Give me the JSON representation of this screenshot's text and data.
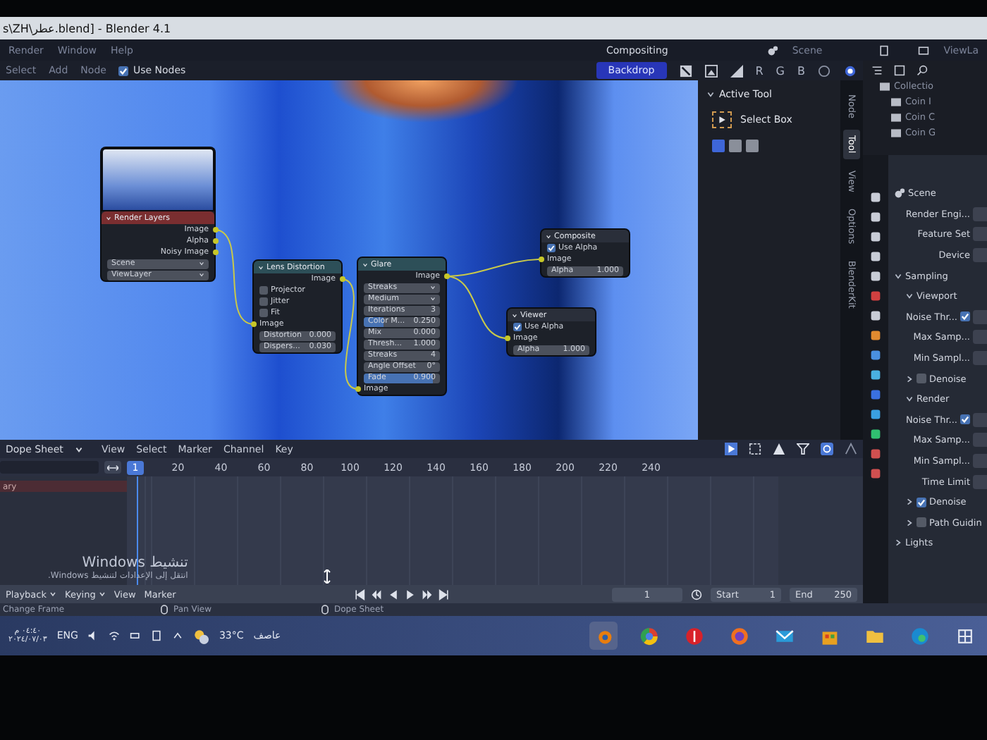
{
  "window": {
    "title": "s\\ZH\\عطر.blend] - Blender 4.1"
  },
  "menu_bar": {
    "items": [
      "Render",
      "Window",
      "Help"
    ],
    "workspace": "Compositing",
    "scene": "Scene",
    "view_layer": "ViewLa"
  },
  "node_header": {
    "items": [
      "Select",
      "Add",
      "Node"
    ],
    "use_nodes": {
      "label": "Use Nodes",
      "checked": true
    },
    "backdrop": {
      "label": "Backdrop",
      "on": true
    },
    "channels": [
      "R",
      "G",
      "B"
    ]
  },
  "nodes": [
    {
      "title": "Render Layers",
      "color": "#7a2e30",
      "preview": true,
      "rows": [
        {
          "kind": "output",
          "label": "Image"
        },
        {
          "kind": "output",
          "label": "Alpha"
        },
        {
          "kind": "output",
          "label": "Noisy Image"
        },
        {
          "kind": "select",
          "label": "Scene"
        },
        {
          "kind": "select",
          "label": "ViewLayer"
        }
      ]
    },
    {
      "title": "Lens Distortion",
      "color": "#2d4f58",
      "preview": false,
      "rows": [
        {
          "kind": "output",
          "label": "Image"
        },
        {
          "kind": "checkbox",
          "label": "Projector",
          "checked": false
        },
        {
          "kind": "checkbox",
          "label": "Jitter",
          "checked": false
        },
        {
          "kind": "checkbox",
          "label": "Fit",
          "checked": false
        },
        {
          "kind": "input",
          "label": "Image"
        },
        {
          "kind": "number",
          "label": "Distortion",
          "value": "0.000"
        },
        {
          "kind": "number",
          "label": "Dispers...",
          "value": "0.030"
        }
      ]
    },
    {
      "title": "Glare",
      "color": "#2d4f58",
      "preview": false,
      "rows": [
        {
          "kind": "output",
          "label": "Image"
        },
        {
          "kind": "select",
          "label": "Streaks"
        },
        {
          "kind": "select",
          "label": "Medium"
        },
        {
          "kind": "number",
          "label": "Iterations",
          "value": "3"
        },
        {
          "kind": "slider",
          "label": "Color M...",
          "value": "0.250",
          "level": 0.25
        },
        {
          "kind": "number",
          "label": "Mix",
          "value": "0.000"
        },
        {
          "kind": "number",
          "label": "Thresh...",
          "value": "1.000"
        },
        {
          "kind": "number",
          "label": "Streaks",
          "value": "4"
        },
        {
          "kind": "number",
          "label": "Angle Offset",
          "value": "0°"
        },
        {
          "kind": "slider",
          "label": "Fade",
          "value": "0.900",
          "level": 0.9
        },
        {
          "kind": "input",
          "label": "Image"
        }
      ]
    },
    {
      "title": "Composite",
      "color": "#2a2f3a",
      "preview": false,
      "rows": [
        {
          "kind": "checkbox",
          "label": "Use Alpha",
          "checked": true
        },
        {
          "kind": "input",
          "label": "Image"
        },
        {
          "kind": "number",
          "label": "Alpha",
          "value": "1.000"
        }
      ]
    },
    {
      "title": "Viewer",
      "color": "#2a2f3a",
      "preview": false,
      "rows": [
        {
          "kind": "checkbox",
          "label": "Use Alpha",
          "checked": true
        },
        {
          "kind": "input",
          "label": "Image"
        },
        {
          "kind": "number",
          "label": "Alpha",
          "value": "1.000"
        }
      ]
    }
  ],
  "sidebar": {
    "panel": "Active Tool",
    "expanded": true,
    "tool": "Select Box",
    "modes": [
      {
        "selected": true
      },
      {
        "selected": false
      },
      {
        "selected": false
      }
    ]
  },
  "sidebar_tabs": [
    {
      "label": "Node",
      "selected": false
    },
    {
      "label": "Tool",
      "selected": true
    },
    {
      "label": "View",
      "selected": false
    },
    {
      "label": "Options",
      "selected": false
    },
    {
      "label": "BlenderKit",
      "selected": false
    }
  ],
  "outliner": {
    "items": [
      "Collectio",
      "Coin I",
      "Coin C",
      "Coin G"
    ]
  },
  "properties": {
    "rows": [
      {
        "kind": "heading",
        "label": "Scene"
      },
      {
        "kind": "field",
        "label": "Render Engi..."
      },
      {
        "kind": "field",
        "label": "Feature Set"
      },
      {
        "kind": "field",
        "label": "Device"
      },
      {
        "kind": "panel",
        "label": "Sampling",
        "expanded": true
      },
      {
        "kind": "subpanel",
        "label": "Viewport",
        "expanded": true
      },
      {
        "kind": "check",
        "label": "Noise Thr...",
        "checked": true
      },
      {
        "kind": "field",
        "label": "Max Samp..."
      },
      {
        "kind": "field",
        "label": "Min Sampl..."
      },
      {
        "kind": "subpanel",
        "label": "Denoise",
        "expanded": false,
        "checked": false
      },
      {
        "kind": "subpanel",
        "label": "Render",
        "expanded": true
      },
      {
        "kind": "check",
        "label": "Noise Thr...",
        "checked": true
      },
      {
        "kind": "field",
        "label": "Max Samp..."
      },
      {
        "kind": "field",
        "label": "Min Sampl..."
      },
      {
        "kind": "field",
        "label": "Time Limit"
      },
      {
        "kind": "subpanel",
        "label": "Denoise",
        "expanded": false,
        "checked": true
      },
      {
        "kind": "subpanel",
        "label": "Path Guidin",
        "expanded": false,
        "checked": false
      },
      {
        "kind": "panel",
        "label": "Lights",
        "expanded": false
      }
    ]
  },
  "dope_sheet": {
    "editor": "Dope Sheet",
    "menu": [
      "View",
      "Select",
      "Marker",
      "Channel",
      "Key"
    ],
    "current_frame": "1",
    "ticks": [
      "20",
      "40",
      "60",
      "80",
      "100",
      "120",
      "140",
      "160",
      "180",
      "200",
      "220",
      "240"
    ],
    "channels": [
      "ary"
    ]
  },
  "activation": {
    "title": "تنشيط Windows",
    "hint": "انتقل إلى الإعدادات لتنشيط Windows."
  },
  "timeline": {
    "menus": [
      {
        "label": "Playback",
        "dropdown": true
      },
      {
        "label": "Keying",
        "dropdown": true
      },
      {
        "label": "View",
        "dropdown": false
      },
      {
        "label": "Marker",
        "dropdown": false
      }
    ],
    "frame": "1",
    "start_label": "Start",
    "start": "1",
    "end_label": "End",
    "end": "250"
  },
  "status_bar": [
    "Change Frame",
    "Pan View",
    "Dope Sheet"
  ],
  "taskbar": {
    "time": "٠٤:٤٠ م",
    "date": "٢٠٢٤/٠٧/٠٣",
    "language": "ENG",
    "temperature": "33°C",
    "weather": "عاصف"
  }
}
